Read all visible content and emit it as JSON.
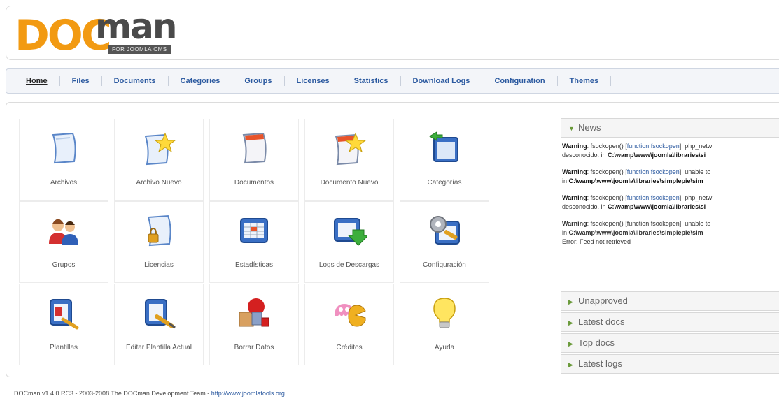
{
  "logo": {
    "doc": "DOC",
    "man": "man",
    "tag": "FOR JOOMLA CMS"
  },
  "menu": [
    {
      "label": "Home",
      "active": true
    },
    {
      "label": "Files"
    },
    {
      "label": "Documents"
    },
    {
      "label": "Categories"
    },
    {
      "label": "Groups"
    },
    {
      "label": "Licenses"
    },
    {
      "label": "Statistics"
    },
    {
      "label": "Download Logs"
    },
    {
      "label": "Configuration"
    },
    {
      "label": "Themes"
    }
  ],
  "grid": [
    {
      "label": "Archivos",
      "icon": "file-icon"
    },
    {
      "label": "Archivo Nuevo",
      "icon": "new-file-icon"
    },
    {
      "label": "Documentos",
      "icon": "document-icon"
    },
    {
      "label": "Documento Nuevo",
      "icon": "new-document-icon"
    },
    {
      "label": "Categorías",
      "icon": "categories-icon"
    },
    {
      "label": "Grupos",
      "icon": "groups-icon"
    },
    {
      "label": "Licencias",
      "icon": "license-icon"
    },
    {
      "label": "Estadísticas",
      "icon": "statistics-icon"
    },
    {
      "label": "Logs de Descargas",
      "icon": "download-logs-icon"
    },
    {
      "label": "Configuración",
      "icon": "configuration-icon"
    },
    {
      "label": "Plantillas",
      "icon": "templates-icon"
    },
    {
      "label": "Editar Plantilla Actual",
      "icon": "edit-template-icon"
    },
    {
      "label": "Borrar Datos",
      "icon": "clear-data-icon"
    },
    {
      "label": "Créditos",
      "icon": "credits-icon"
    },
    {
      "label": "Ayuda",
      "icon": "help-icon"
    }
  ],
  "news": {
    "title": "News",
    "warnings": [
      {
        "prefix": "Warning",
        "fn_pre": ": fsockopen() [",
        "fn": "function.fsockopen",
        "fn_post": "]: php_netw",
        "line2_pre": "desconocido. in ",
        "line2_path": "C:\\wamp\\www\\joomla\\libraries\\si"
      },
      {
        "prefix": "Warning",
        "fn_pre": ": fsockopen() [",
        "fn": "function.fsockopen",
        "fn_post": "]: unable to",
        "line2_pre": "in ",
        "line2_path": "C:\\wamp\\www\\joomla\\libraries\\simplepie\\sim"
      },
      {
        "prefix": "Warning",
        "fn_pre": ": fsockopen() [",
        "fn": "function.fsockopen",
        "fn_post": "]: php_netw",
        "line2_pre": "desconocido. in ",
        "line2_path": "C:\\wamp\\www\\joomla\\libraries\\si"
      },
      {
        "prefix": "Warning",
        "fn_pre": ": fsockopen() [",
        "fn": "function.fsockopen",
        "fn_post": "]: unable to",
        "line2_pre": "in ",
        "line2_path": "C:\\wamp\\www\\joomla\\libraries\\simplepie\\sim"
      }
    ],
    "error": "Error: Feed not retrieved"
  },
  "panels": [
    "Unapproved",
    "Latest docs",
    "Top docs",
    "Latest logs"
  ],
  "footer": {
    "text": "DOCman v1.4.0 RC3 - 2003-2008 The DOCman Development Team - ",
    "link": "http://www.joomlatools.org"
  }
}
